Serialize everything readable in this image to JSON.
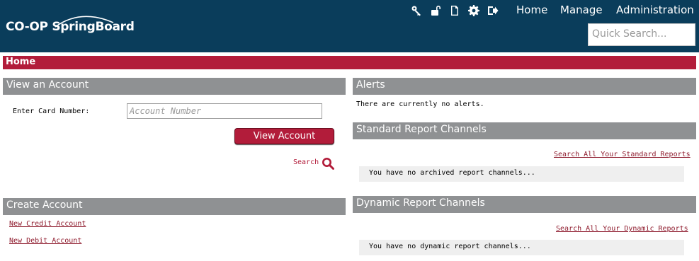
{
  "header": {
    "logo_left": "CO-OP",
    "logo_right": "SpringBoard",
    "icons": [
      "key-icon",
      "unlock-icon",
      "document-icon",
      "gear-icon",
      "sign-out-icon"
    ],
    "nav": {
      "home": "Home",
      "manage": "Manage",
      "administration": "Administration"
    },
    "quick_search_placeholder": "Quick Search..."
  },
  "breadcrumb": {
    "title": "Home"
  },
  "view_account": {
    "title": "View an Account",
    "card_label": "Enter Card Number:",
    "card_placeholder": "Account Number",
    "button_label": "View Account",
    "search_label": "Search"
  },
  "create_account": {
    "title": "Create Account",
    "links": [
      "New Credit Account",
      "New Debit Account"
    ]
  },
  "alerts": {
    "title": "Alerts",
    "message": "There are currently no alerts."
  },
  "standard_reports": {
    "title": "Standard Report Channels",
    "search_link": "Search All Your Standard Reports",
    "message": "You have no archived report channels..."
  },
  "dynamic_reports": {
    "title": "Dynamic Report Channels",
    "search_link": "Search All Your Dynamic Reports",
    "message": "You have no dynamic report channels..."
  },
  "colors": {
    "header_bg": "#0a3d5b",
    "accent": "#b21c3a",
    "section_header": "#8f9193",
    "message_bg": "#efefef"
  }
}
